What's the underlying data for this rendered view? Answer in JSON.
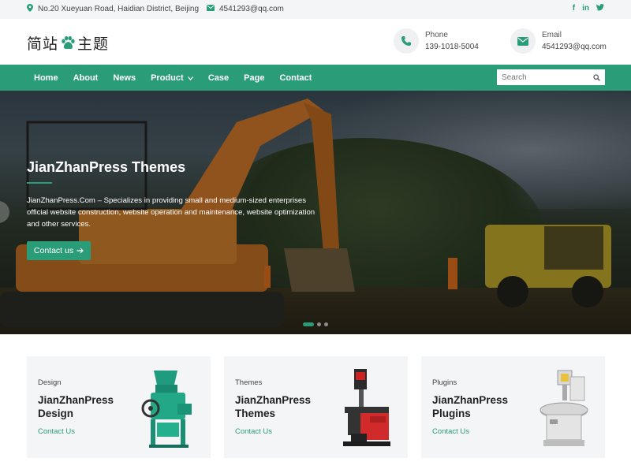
{
  "topbar": {
    "address": "No.20 Xueyuan Road, Haidian District, Beijing",
    "email": "4541293@qq.com",
    "social": [
      "f",
      "in",
      "t"
    ]
  },
  "header": {
    "logo_left": "简站",
    "logo_right": "主题",
    "phone_label": "Phone",
    "phone_value": "139-1018-5004",
    "email_label": "Email",
    "email_value": "4541293@qq.com"
  },
  "nav": {
    "items": [
      {
        "label": "Home"
      },
      {
        "label": "About"
      },
      {
        "label": "News"
      },
      {
        "label": "Product",
        "has_dropdown": true
      },
      {
        "label": "Case"
      },
      {
        "label": "Page"
      },
      {
        "label": "Contact"
      }
    ],
    "search_placeholder": "Search"
  },
  "hero": {
    "title": "JianZhanPress Themes",
    "description": "JianZhanPress.Com – Specializes in providing small and medium-sized enterprises official website construction, website operation and maintenance, website optimization and other services.",
    "cta_label": "Contact us",
    "slides_total": 3,
    "active_slide": 1
  },
  "cards": [
    {
      "category": "Design",
      "title": "JianZhanPress Design",
      "link": "Contact Us",
      "image": "grain-mill-machine"
    },
    {
      "category": "Themes",
      "title": "JianZhanPress Themes",
      "link": "Contact Us",
      "image": "tire-changer-machine"
    },
    {
      "category": "Plugins",
      "title": "JianZhanPress Plugins",
      "link": "Contact Us",
      "image": "rotary-press-machine"
    }
  ],
  "colors": {
    "accent": "#2a9d78",
    "topbar_bg": "#f4f5f7",
    "card_bg": "#f4f5f7"
  }
}
